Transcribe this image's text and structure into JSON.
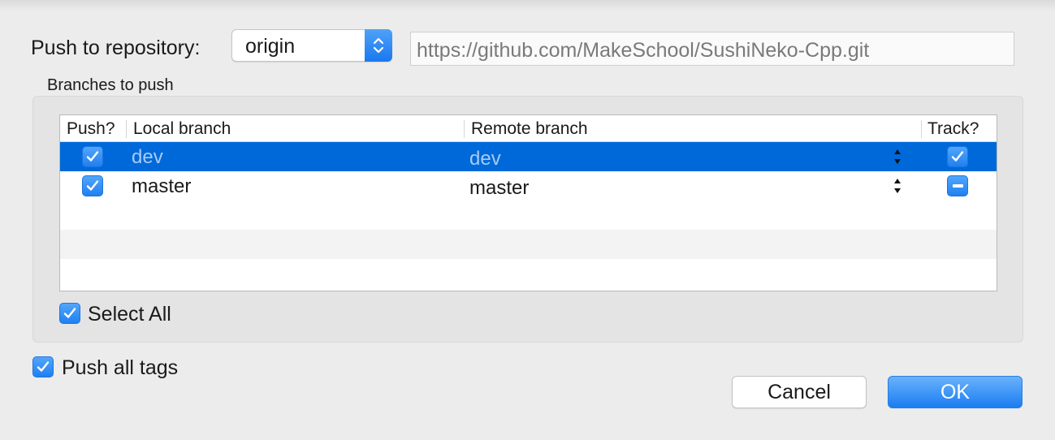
{
  "repository": {
    "label": "Push to repository:",
    "selected": "origin",
    "url": "https://github.com/MakeSchool/SushiNeko-Cpp.git"
  },
  "branches": {
    "section_label": "Branches to push",
    "columns": {
      "push": "Push?",
      "local": "Local branch",
      "remote": "Remote branch",
      "track": "Track?"
    },
    "rows": [
      {
        "push": true,
        "local": "dev",
        "remote": "dev",
        "track": "checked",
        "selected": true
      },
      {
        "push": true,
        "local": "master",
        "remote": "master",
        "track": "mixed",
        "selected": false
      }
    ],
    "select_all_label": "Select All",
    "select_all_checked": true
  },
  "options": {
    "push_all_tags_label": "Push all tags",
    "push_all_tags_checked": true
  },
  "buttons": {
    "cancel": "Cancel",
    "ok": "OK"
  },
  "colors": {
    "accent": "#1a7df1",
    "selection": "#0069d9"
  }
}
